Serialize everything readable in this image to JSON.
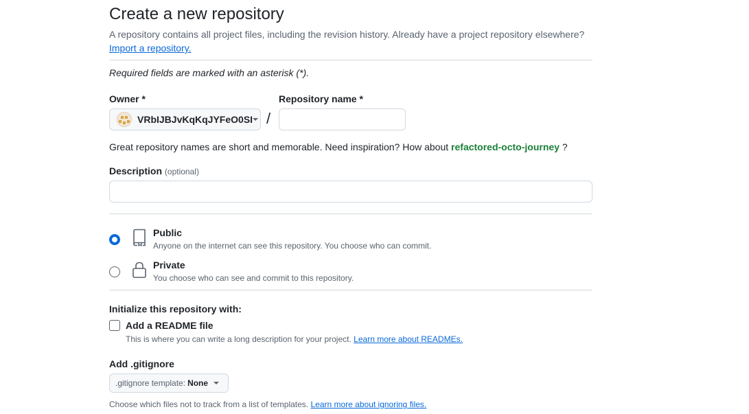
{
  "header": {
    "title": "Create a new repository",
    "subtitle": "A repository contains all project files, including the revision history. Already have a project repository elsewhere?",
    "import_link": "Import a repository."
  },
  "form": {
    "required_note": "Required fields are marked with an asterisk (*).",
    "owner": {
      "label": "Owner *",
      "value": "VRbIJBJvKqKqJYFeO0SI"
    },
    "slash": "/",
    "repo_name": {
      "label": "Repository name *",
      "value": "",
      "placeholder": ""
    },
    "suggestion": {
      "prefix": "Great repository names are short and memorable. Need inspiration? How about",
      "name": "refactored-octo-journey",
      "suffix": "?"
    },
    "description": {
      "label": "Description",
      "optional": "(optional)",
      "value": ""
    },
    "visibility": {
      "selected": "public",
      "options": [
        {
          "id": "public",
          "title": "Public",
          "desc": "Anyone on the internet can see this repository. You choose who can commit.",
          "icon": "repo-icon"
        },
        {
          "id": "private",
          "title": "Private",
          "desc": "You choose who can see and commit to this repository.",
          "icon": "lock-icon"
        }
      ]
    },
    "initialize": {
      "label": "Initialize this repository with:",
      "readme": {
        "label": "Add a README file",
        "checked": false,
        "desc": "This is where you can write a long description for your project.",
        "link": "Learn more about READMEs."
      }
    },
    "gitignore": {
      "label": "Add .gitignore",
      "button_prefix": ".gitignore template:",
      "button_value": "None",
      "desc": "Choose which files not to track from a list of templates.",
      "link": "Learn more about ignoring files."
    }
  },
  "colors": {
    "accent": "#0969da",
    "suggestion": "#1a7f37",
    "muted": "#59636e",
    "border": "#d1d9e0"
  }
}
